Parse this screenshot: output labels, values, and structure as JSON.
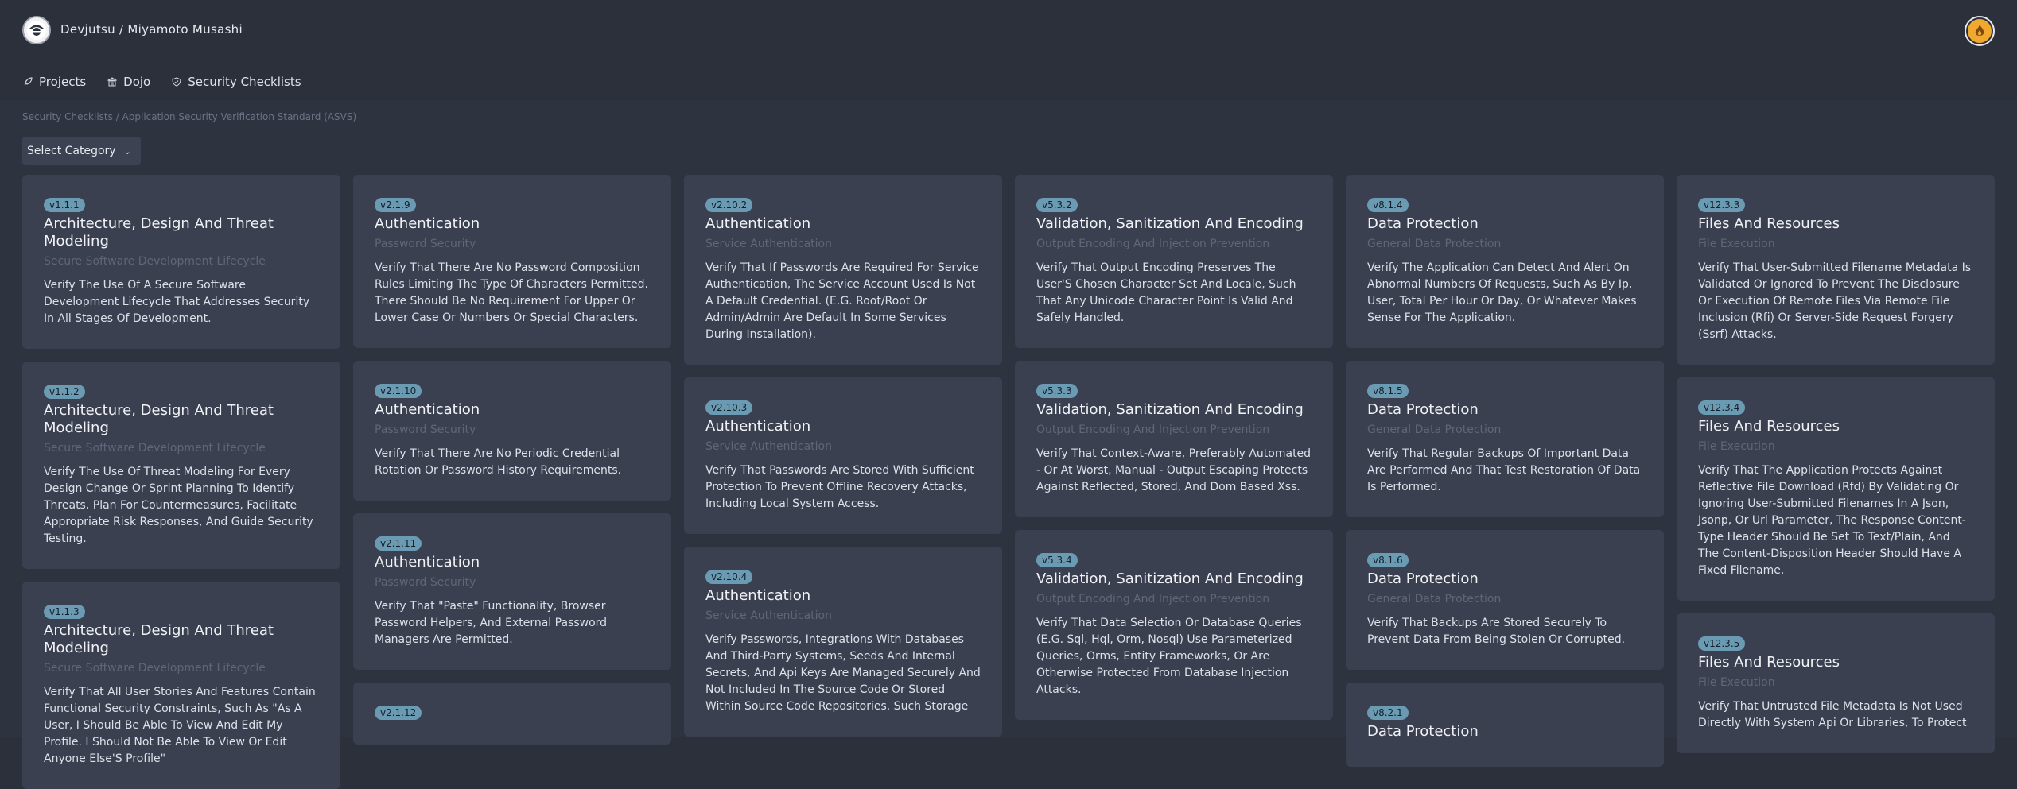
{
  "brand": {
    "text": "Devjutsu / Miyamoto Musashi",
    "logo_icon": "samurai-logo-icon",
    "avatar_icon": "flame-avatar-icon"
  },
  "nav": [
    {
      "label": "Projects",
      "icon": "rocket-icon"
    },
    {
      "label": "Dojo",
      "icon": "temple-icon"
    },
    {
      "label": "Security Checklists",
      "icon": "shield-icon"
    }
  ],
  "breadcrumb": "Security Checklists / Application Security Verification Standard (ASVS)",
  "select": {
    "label": "Select Category"
  },
  "columns": [
    [
      {
        "id": "v1.1.1",
        "title": "Architecture, Design And Threat Modeling",
        "sub": "Secure Software Development Lifecycle",
        "desc": "Verify The Use Of A Secure Software Development Lifecycle That Addresses Security In All Stages Of Development."
      },
      {
        "id": "v1.1.2",
        "title": "Architecture, Design And Threat Modeling",
        "sub": "Secure Software Development Lifecycle",
        "desc": "Verify The Use Of Threat Modeling For Every Design Change Or Sprint Planning To Identify Threats, Plan For Countermeasures, Facilitate Appropriate Risk Responses, And Guide Security Testing."
      },
      {
        "id": "v1.1.3",
        "title": "Architecture, Design And Threat Modeling",
        "sub": "Secure Software Development Lifecycle",
        "desc": "Verify That All User Stories And Features Contain Functional Security Constraints, Such As \"As A User, I Should Be Able To View And Edit My Profile. I Should Not Be Able To View Or Edit Anyone Else'S Profile\""
      }
    ],
    [
      {
        "id": "v2.1.9",
        "title": "Authentication",
        "sub": "Password Security",
        "desc": "Verify That There Are No Password Composition Rules Limiting The Type Of Characters Permitted. There Should Be No Requirement For Upper Or Lower Case Or Numbers Or Special Characters."
      },
      {
        "id": "v2.1.10",
        "title": "Authentication",
        "sub": "Password Security",
        "desc": "Verify That There Are No Periodic Credential Rotation Or Password History Requirements."
      },
      {
        "id": "v2.1.11",
        "title": "Authentication",
        "sub": "Password Security",
        "desc": "Verify That \"Paste\" Functionality, Browser Password Helpers, And External Password Managers Are Permitted."
      },
      {
        "id": "v2.1.12",
        "title": "",
        "sub": "",
        "desc": ""
      }
    ],
    [
      {
        "id": "v2.10.2",
        "title": "Authentication",
        "sub": "Service Authentication",
        "desc": "Verify That If Passwords Are Required For Service Authentication, The Service Account Used Is Not A Default Credential. (E.G. Root/Root Or Admin/Admin Are Default In Some Services During Installation)."
      },
      {
        "id": "v2.10.3",
        "title": "Authentication",
        "sub": "Service Authentication",
        "desc": "Verify That Passwords Are Stored With Sufficient Protection To Prevent Offline Recovery Attacks, Including Local System Access."
      },
      {
        "id": "v2.10.4",
        "title": "Authentication",
        "sub": "Service Authentication",
        "desc": "Verify Passwords, Integrations With Databases And Third-Party Systems, Seeds And Internal Secrets, And Api Keys Are Managed Securely And Not Included In The Source Code Or Stored Within Source Code Repositories. Such Storage"
      }
    ],
    [
      {
        "id": "v5.3.2",
        "title": "Validation, Sanitization And Encoding",
        "sub": "Output Encoding And Injection Prevention",
        "desc": "Verify That Output Encoding Preserves The User'S Chosen Character Set And Locale, Such That Any Unicode Character Point Is Valid And Safely Handled."
      },
      {
        "id": "v5.3.3",
        "title": "Validation, Sanitization And Encoding",
        "sub": "Output Encoding And Injection Prevention",
        "desc": "Verify That Context-Aware, Preferably Automated - Or At Worst, Manual - Output Escaping Protects Against Reflected, Stored, And Dom Based Xss."
      },
      {
        "id": "v5.3.4",
        "title": "Validation, Sanitization And Encoding",
        "sub": "Output Encoding And Injection Prevention",
        "desc": "Verify That Data Selection Or Database Queries (E.G. Sql, Hql, Orm, Nosql) Use Parameterized Queries, Orms, Entity Frameworks, Or Are Otherwise Protected From Database Injection Attacks."
      }
    ],
    [
      {
        "id": "v8.1.4",
        "title": "Data Protection",
        "sub": "General Data Protection",
        "desc": "Verify The Application Can Detect And Alert On Abnormal Numbers Of Requests, Such As By Ip, User, Total Per Hour Or Day, Or Whatever Makes Sense For The Application."
      },
      {
        "id": "v8.1.5",
        "title": "Data Protection",
        "sub": "General Data Protection",
        "desc": "Verify That Regular Backups Of Important Data Are Performed And That Test Restoration Of Data Is Performed."
      },
      {
        "id": "v8.1.6",
        "title": "Data Protection",
        "sub": "General Data Protection",
        "desc": "Verify That Backups Are Stored Securely To Prevent Data From Being Stolen Or Corrupted."
      },
      {
        "id": "v8.2.1",
        "title": "Data Protection",
        "sub": "",
        "desc": ""
      }
    ],
    [
      {
        "id": "v12.3.3",
        "title": "Files And Resources",
        "sub": "File Execution",
        "desc": "Verify That User-Submitted Filename Metadata Is Validated Or Ignored To Prevent The Disclosure Or Execution Of Remote Files Via Remote File Inclusion (Rfi) Or Server-Side Request Forgery (Ssrf) Attacks."
      },
      {
        "id": "v12.3.4",
        "title": "Files And Resources",
        "sub": "File Execution",
        "desc": "Verify That The Application Protects Against Reflective File Download (Rfd) By Validating Or Ignoring User-Submitted Filenames In A Json, Jsonp, Or Url Parameter, The Response Content-Type Header Should Be Set To Text/Plain, And The Content-Disposition Header Should Have A Fixed Filename."
      },
      {
        "id": "v12.3.5",
        "title": "Files And Resources",
        "sub": "File Execution",
        "desc": "Verify That Untrusted File Metadata Is Not Used Directly With System Api Or Libraries, To Protect"
      }
    ]
  ]
}
